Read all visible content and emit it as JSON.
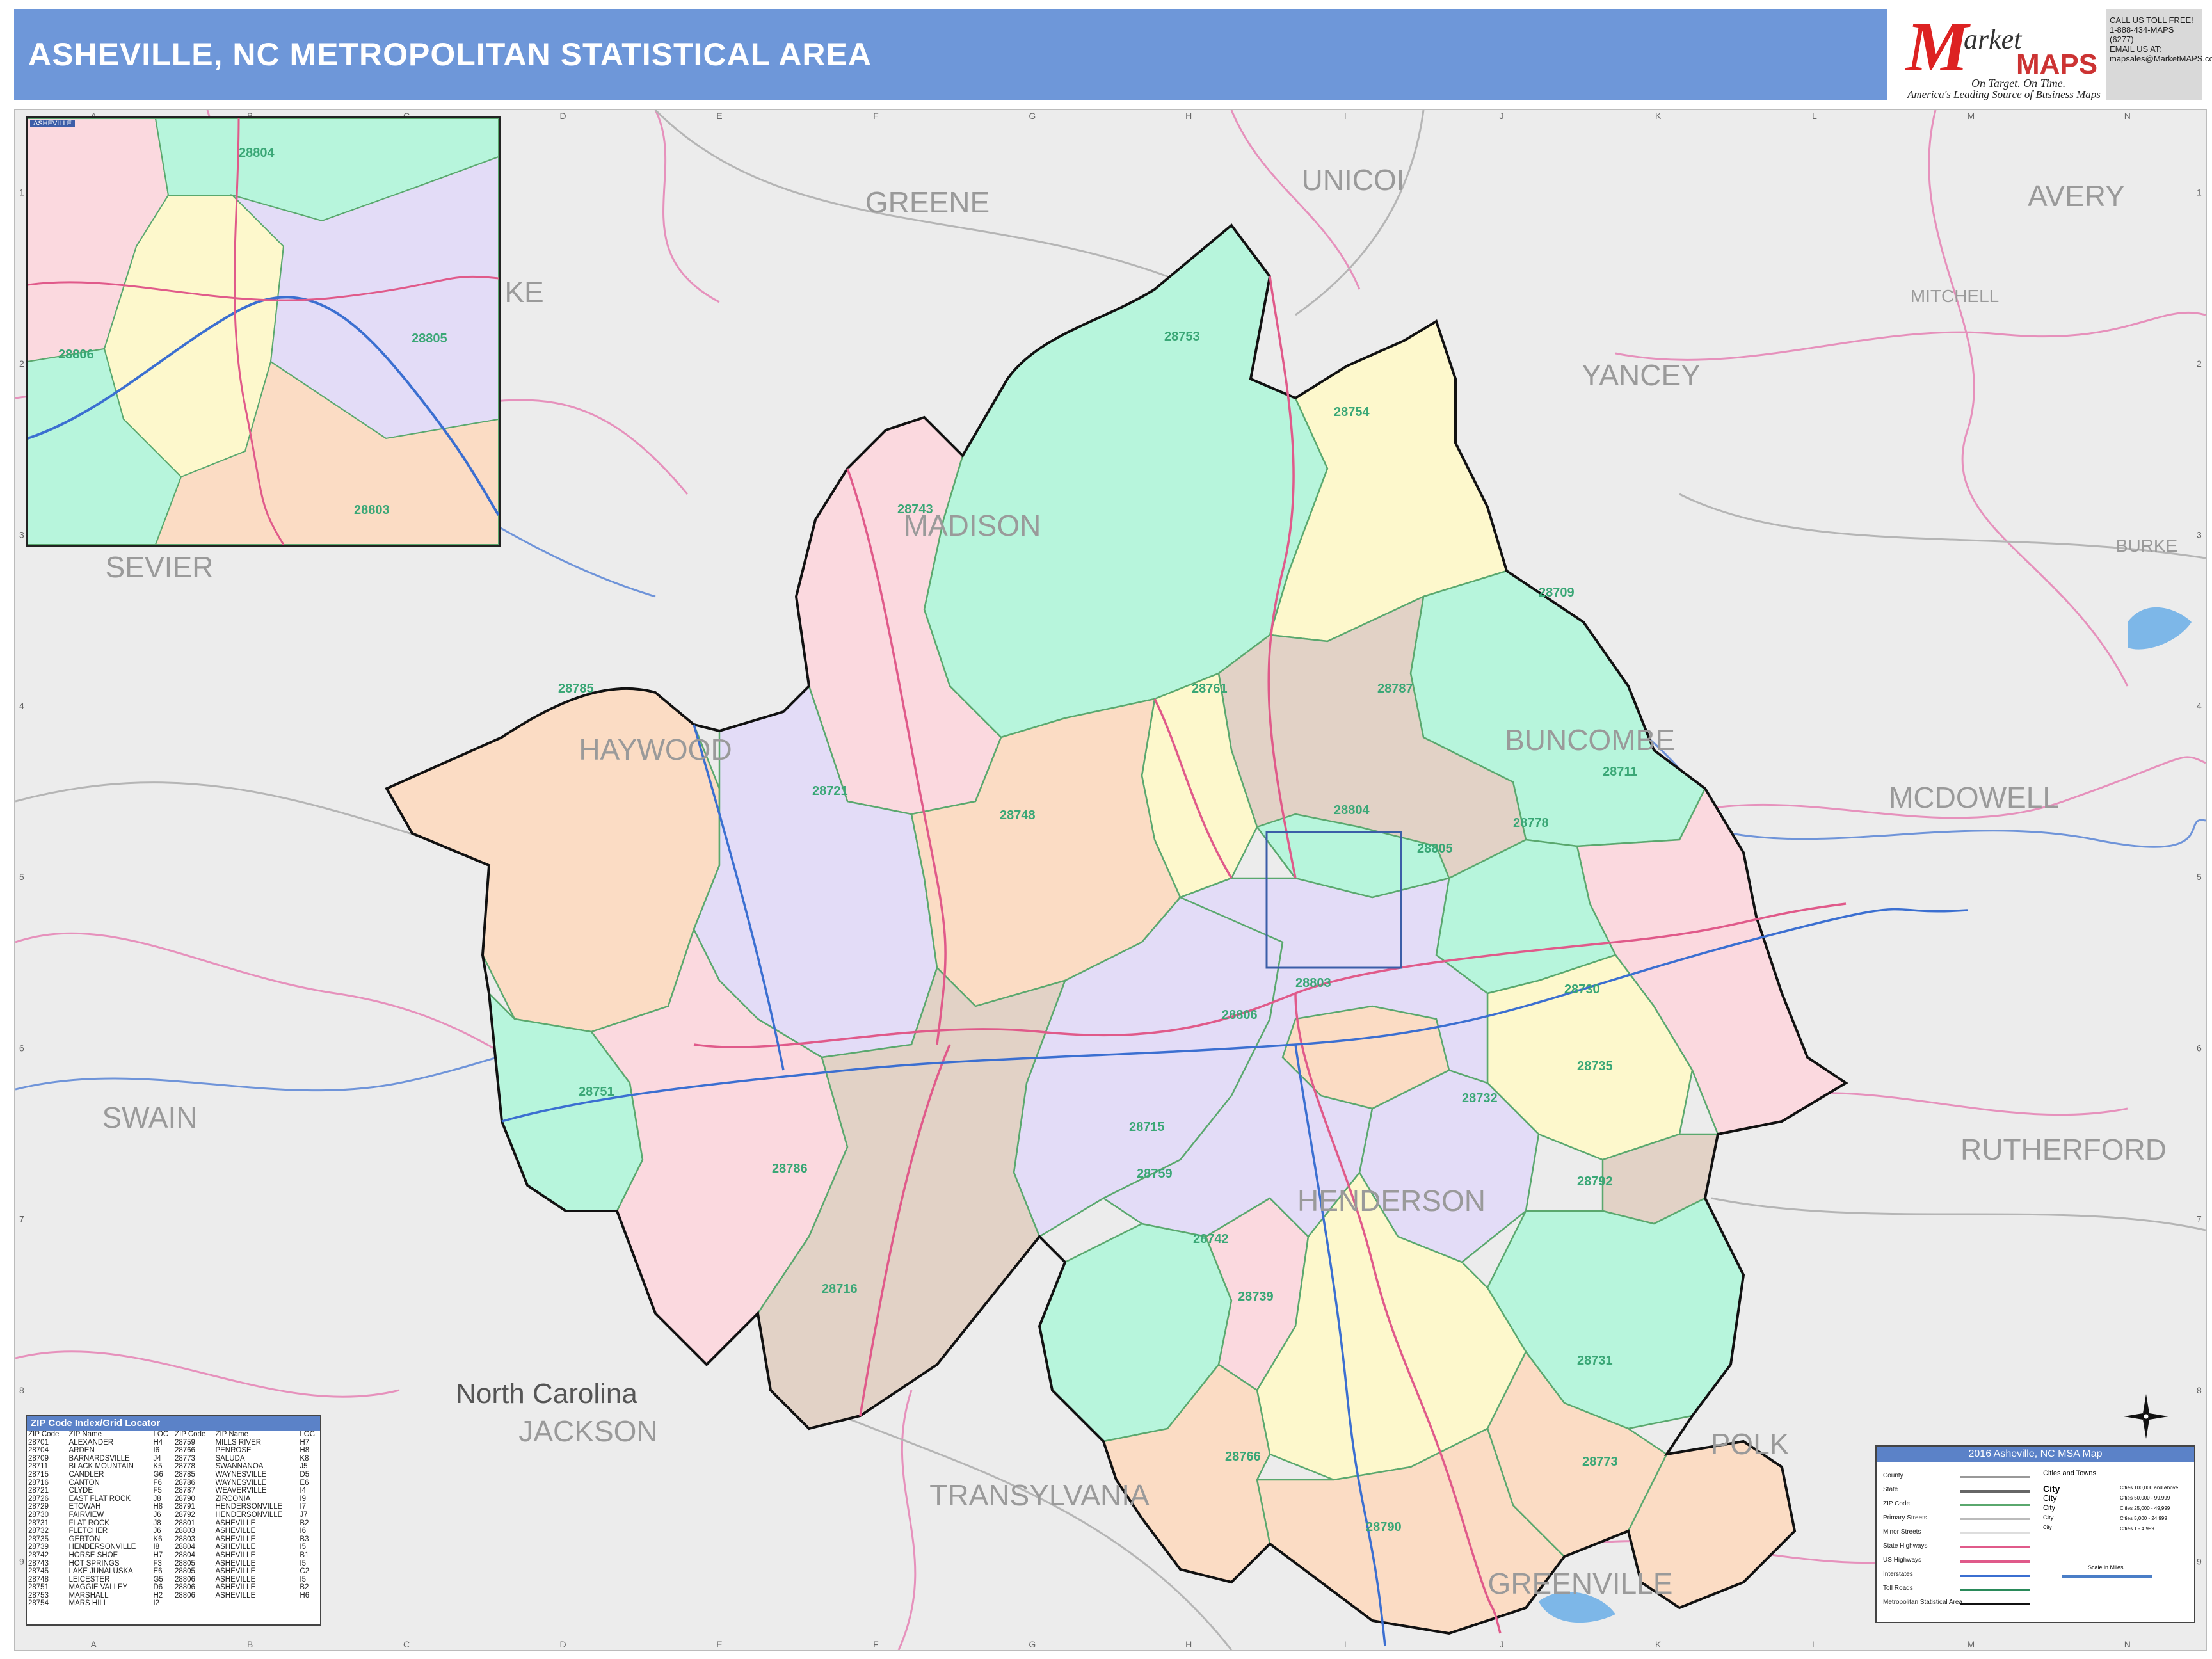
{
  "header": {
    "title": "ASHEVILLE, NC METROPOLITAN STATISTICAL AREA",
    "background": "#6e97d9"
  },
  "logo": {
    "letter": "M",
    "word": "arket",
    "maps": "MAPS",
    "tagline": "On Target.  On Time.",
    "subline": "America's Leading Source of Business Maps"
  },
  "contact": {
    "line1": "CALL US TOLL FREE!",
    "line2": "1-888-434-MAPS  (6277)",
    "line3": "EMAIL US AT:",
    "line4": "mapsales@MarketMAPS.com"
  },
  "map": {
    "grid_columns": [
      "A",
      "B",
      "C",
      "D",
      "E",
      "F",
      "G",
      "H",
      "I",
      "J",
      "K",
      "L",
      "M",
      "N"
    ],
    "grid_rows": [
      "1",
      "2",
      "3",
      "4",
      "5",
      "6",
      "7",
      "8",
      "9"
    ],
    "counties_outside": [
      {
        "name": "GREENE"
      },
      {
        "name": "UNICOI"
      },
      {
        "name": "AVERY"
      },
      {
        "name": "MITCHELL"
      },
      {
        "name": "YANCEY"
      },
      {
        "name": "SEVIER"
      },
      {
        "name": "BURKE"
      },
      {
        "name": "MCDOWELL"
      },
      {
        "name": "SWAIN"
      },
      {
        "name": "RUTHERFORD"
      },
      {
        "name": "JACKSON"
      },
      {
        "name": "TRANSYLVANIA"
      },
      {
        "name": "POLK"
      },
      {
        "name": "GREENVILLE"
      },
      {
        "name": "KE"
      }
    ],
    "counties_inside": [
      {
        "name": "MADISON"
      },
      {
        "name": "HAYWOOD"
      },
      {
        "name": "BUNCOMBE"
      },
      {
        "name": "HENDERSON"
      }
    ],
    "state_label": "North Carolina",
    "zip_labels": [
      "28753",
      "28754",
      "28743",
      "28709",
      "28785",
      "28787",
      "28761",
      "28721",
      "28748",
      "28711",
      "28778",
      "28730",
      "28751",
      "28715",
      "28786",
      "28759",
      "28742",
      "28732",
      "28735",
      "28792",
      "28716",
      "28739",
      "28731",
      "28790",
      "28773",
      "28766",
      "28806",
      "28803",
      "28805",
      "28804"
    ]
  },
  "inset": {
    "title": "ASHEVILLE",
    "zips": [
      "28804",
      "28806",
      "28805",
      "28803"
    ]
  },
  "zip_index": {
    "title": "ZIP Code Index/Grid Locator",
    "headers": [
      "ZIP Code",
      "ZIP Name",
      "LOC",
      "ZIP Code",
      "ZIP Name",
      "LOC"
    ],
    "rows": [
      [
        "28701",
        "ALEXANDER",
        "H4",
        "28759",
        "MILLS RIVER",
        "H7"
      ],
      [
        "28704",
        "ARDEN",
        "I6",
        "28766",
        "PENROSE",
        "H8"
      ],
      [
        "28709",
        "BARNARDSVILLE",
        "J4",
        "28773",
        "SALUDA",
        "K8"
      ],
      [
        "28711",
        "BLACK MOUNTAIN",
        "K5",
        "28778",
        "SWANNANOA",
        "J5"
      ],
      [
        "28715",
        "CANDLER",
        "G6",
        "28785",
        "WAYNESVILLE",
        "D5"
      ],
      [
        "28716",
        "CANTON",
        "F6",
        "28786",
        "WAYNESVILLE",
        "E6"
      ],
      [
        "28721",
        "CLYDE",
        "F5",
        "28787",
        "WEAVERVILLE",
        "I4"
      ],
      [
        "28726",
        "EAST FLAT ROCK",
        "J8",
        "28790",
        "ZIRCONIA",
        "I9"
      ],
      [
        "28729",
        "ETOWAH",
        "H8",
        "28791",
        "HENDERSONVILLE",
        "I7"
      ],
      [
        "28730",
        "FAIRVIEW",
        "J6",
        "28792",
        "HENDERSONVILLE",
        "J7"
      ],
      [
        "28731",
        "FLAT ROCK",
        "J8",
        "28801",
        "ASHEVILLE",
        "B2"
      ],
      [
        "28732",
        "FLETCHER",
        "J6",
        "28803",
        "ASHEVILLE",
        "I6"
      ],
      [
        "28735",
        "GERTON",
        "K6",
        "28803",
        "ASHEVILLE",
        "B3"
      ],
      [
        "28739",
        "HENDERSONVILLE",
        "I8",
        "28804",
        "ASHEVILLE",
        "I5"
      ],
      [
        "28742",
        "HORSE SHOE",
        "H7",
        "28804",
        "ASHEVILLE",
        "B1"
      ],
      [
        "28743",
        "HOT SPRINGS",
        "F3",
        "28805",
        "ASHEVILLE",
        "I5"
      ],
      [
        "28745",
        "LAKE JUNALUSKA",
        "E6",
        "28805",
        "ASHEVILLE",
        "C2"
      ],
      [
        "28748",
        "LEICESTER",
        "G5",
        "28806",
        "ASHEVILLE",
        "I5"
      ],
      [
        "28751",
        "MAGGIE VALLEY",
        "D6",
        "28806",
        "ASHEVILLE",
        "B2"
      ],
      [
        "28753",
        "MARSHALL",
        "H2",
        "28806",
        "ASHEVILLE",
        "H6"
      ],
      [
        "28754",
        "MARS HILL",
        "I2",
        "",
        "",
        ""
      ]
    ]
  },
  "legend": {
    "title": "2016 Asheville, NC MSA Map",
    "items": [
      "County",
      "State",
      "ZIP Code",
      "Primary Streets",
      "Minor Streets",
      "State Highways",
      "US Highways",
      "Interstates",
      "Toll Roads",
      "Metropolitan Statistical Area"
    ],
    "cities_title": "Cities and Towns",
    "cities": [
      "City",
      "City",
      "City",
      "City",
      "City"
    ],
    "city_pops": [
      "Cities 100,000 and Above",
      "Cities 50,000 - 99,999",
      "Cities 25,000 - 49,999",
      "Cities 5,000 - 24,999",
      "Cities 1 - 4,999"
    ],
    "scale_label": "Scale in Miles"
  },
  "colors": {
    "zone_green": "#b7f5dc",
    "zone_pink": "#fbd9df",
    "zone_yellow": "#fdf8cc",
    "zone_lavender": "#e3dcf7",
    "zone_peach": "#fbdcc4",
    "zone_tan": "#e2d2c6",
    "highway": "#e05a8a",
    "msa_border": "#111111"
  }
}
